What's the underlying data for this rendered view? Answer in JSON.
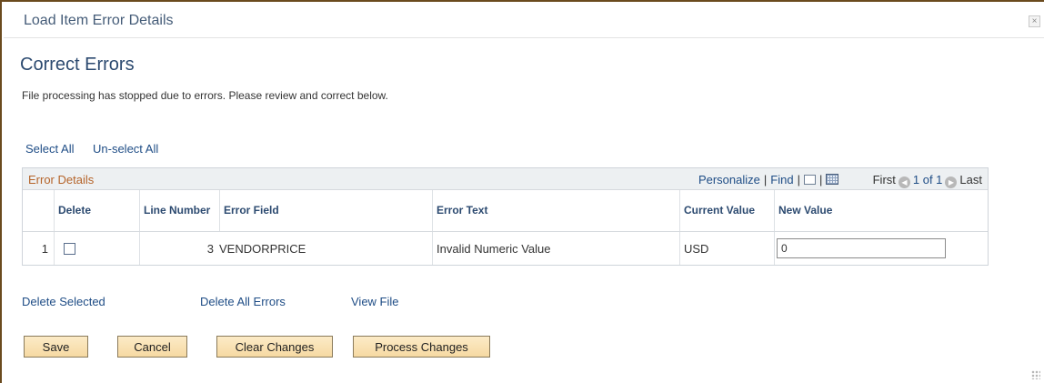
{
  "window": {
    "title": "Load Item Error Details",
    "close_symbol": "×"
  },
  "page": {
    "heading": "Correct Errors",
    "intro": "File processing has stopped due to errors. Please review and correct below."
  },
  "selection": {
    "select_all": "Select All",
    "unselect_all": "Un-select All"
  },
  "grid": {
    "title": "Error Details",
    "personalize": "Personalize",
    "find": "Find",
    "separator": "|",
    "first": "First",
    "range": "1 of 1",
    "last": "Last",
    "columns": {
      "delete": "Delete",
      "line_number": "Line Number",
      "error_field": "Error Field",
      "error_text": "Error Text",
      "current_value": "Current Value",
      "new_value": "New Value"
    },
    "rows": [
      {
        "row_num": "1",
        "delete_checked": false,
        "line_number": "3",
        "error_field": "VENDORPRICE",
        "error_text": "Invalid Numeric Value",
        "current_value": "USD",
        "new_value": "0"
      }
    ]
  },
  "actions": {
    "delete_selected": "Delete Selected",
    "delete_all_errors": "Delete All Errors",
    "view_file": "View File"
  },
  "buttons": {
    "save": "Save",
    "cancel": "Cancel",
    "clear_changes": "Clear Changes",
    "process_changes": "Process Changes"
  },
  "colors": {
    "heading": "#2c4a70",
    "link": "#1f4d86",
    "grid_title": "#b5642a",
    "button_bg": "#f6d9a2"
  }
}
